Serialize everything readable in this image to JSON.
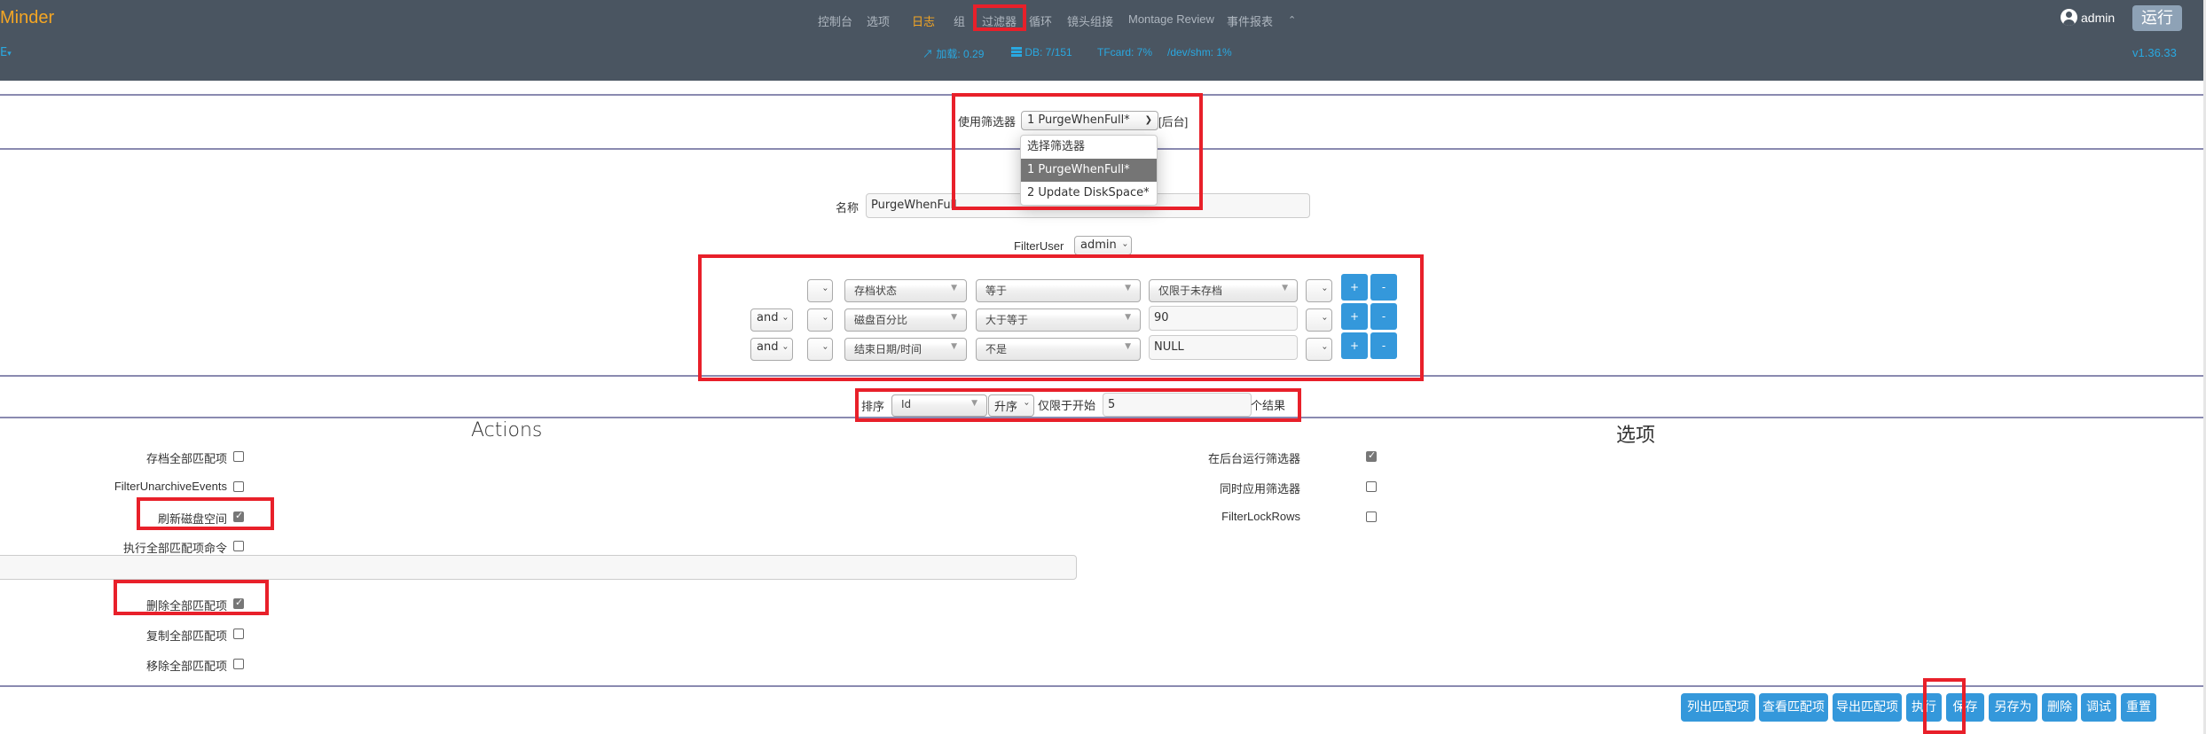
{
  "header": {
    "brand": "Minder",
    "lang_menu": "E",
    "nav": [
      "控制台",
      "选项",
      "日志",
      "组",
      "过滤器",
      "循环",
      "镜头组接",
      "Montage Review",
      "事件报表"
    ],
    "nav_active": "日志",
    "nav_collapse_icon": "chevron-up-icon",
    "stats": {
      "load": "加载: 0.29",
      "db": "DB: 7/151",
      "tfcard": "TFcard: 7%",
      "shm": "/dev/shm: 1%"
    },
    "user": "admin",
    "run_state": "运行",
    "version": "v1.36.33"
  },
  "filter_select": {
    "label": "使用筛选器",
    "value": "1 PurgeWhenFull*",
    "background_tag": "[后台]",
    "options": [
      "选择筛选器",
      "1 PurgeWhenFull*",
      "2 Update DiskSpace*"
    ],
    "highlighted": "1 PurgeWhenFull*"
  },
  "name_field": {
    "label": "名称",
    "value": "PurgeWhenFull"
  },
  "filter_user": {
    "label": "FilterUser",
    "value": "admin"
  },
  "terms": [
    {
      "conj": "",
      "paren_open": "",
      "attr": "存档状态",
      "op": "等于",
      "value": "仅限于未存档",
      "value_is_select": true,
      "paren_close": ""
    },
    {
      "conj": "and",
      "paren_open": "",
      "attr": "磁盘百分比",
      "op": "大于等于",
      "value": "90",
      "value_is_select": false,
      "paren_close": ""
    },
    {
      "conj": "and",
      "paren_open": "",
      "attr": "结束日期/时间",
      "op": "不是",
      "value": "NULL",
      "value_is_select": false,
      "paren_close": ""
    }
  ],
  "term_buttons": {
    "add": "+",
    "remove": "-"
  },
  "sort": {
    "label": "排序",
    "field": "Id",
    "direction": "升序",
    "limit_label": "仅限于开始",
    "limit_value": "5",
    "limit_suffix": "个结果"
  },
  "actions": {
    "title": "Actions",
    "items": [
      {
        "label": "存档全部匹配项",
        "checked": false
      },
      {
        "label": "FilterUnarchiveEvents",
        "checked": false
      },
      {
        "label": "刷新磁盘空间",
        "checked": true
      },
      {
        "label": "执行全部匹配项命令",
        "checked": false
      },
      {
        "label": "删除全部匹配项",
        "checked": true
      },
      {
        "label": "复制全部匹配项",
        "checked": false
      },
      {
        "label": "移除全部匹配项",
        "checked": false
      }
    ],
    "command_input": ""
  },
  "options": {
    "title": "选项",
    "items": [
      {
        "label": "在后台运行筛选器",
        "checked": true
      },
      {
        "label": "同时应用筛选器",
        "checked": false
      },
      {
        "label": "FilterLockRows",
        "checked": false
      }
    ]
  },
  "footer_buttons": [
    "列出匹配项",
    "查看匹配项",
    "导出匹配项",
    "执行",
    "保存",
    "另存为",
    "删除",
    "调试",
    "重置"
  ],
  "colors": {
    "header_bg": "#4a5561",
    "brand": "#f5a623",
    "link": "#29a8e0",
    "button": "#3498db",
    "highlight_box": "#e8202a"
  }
}
